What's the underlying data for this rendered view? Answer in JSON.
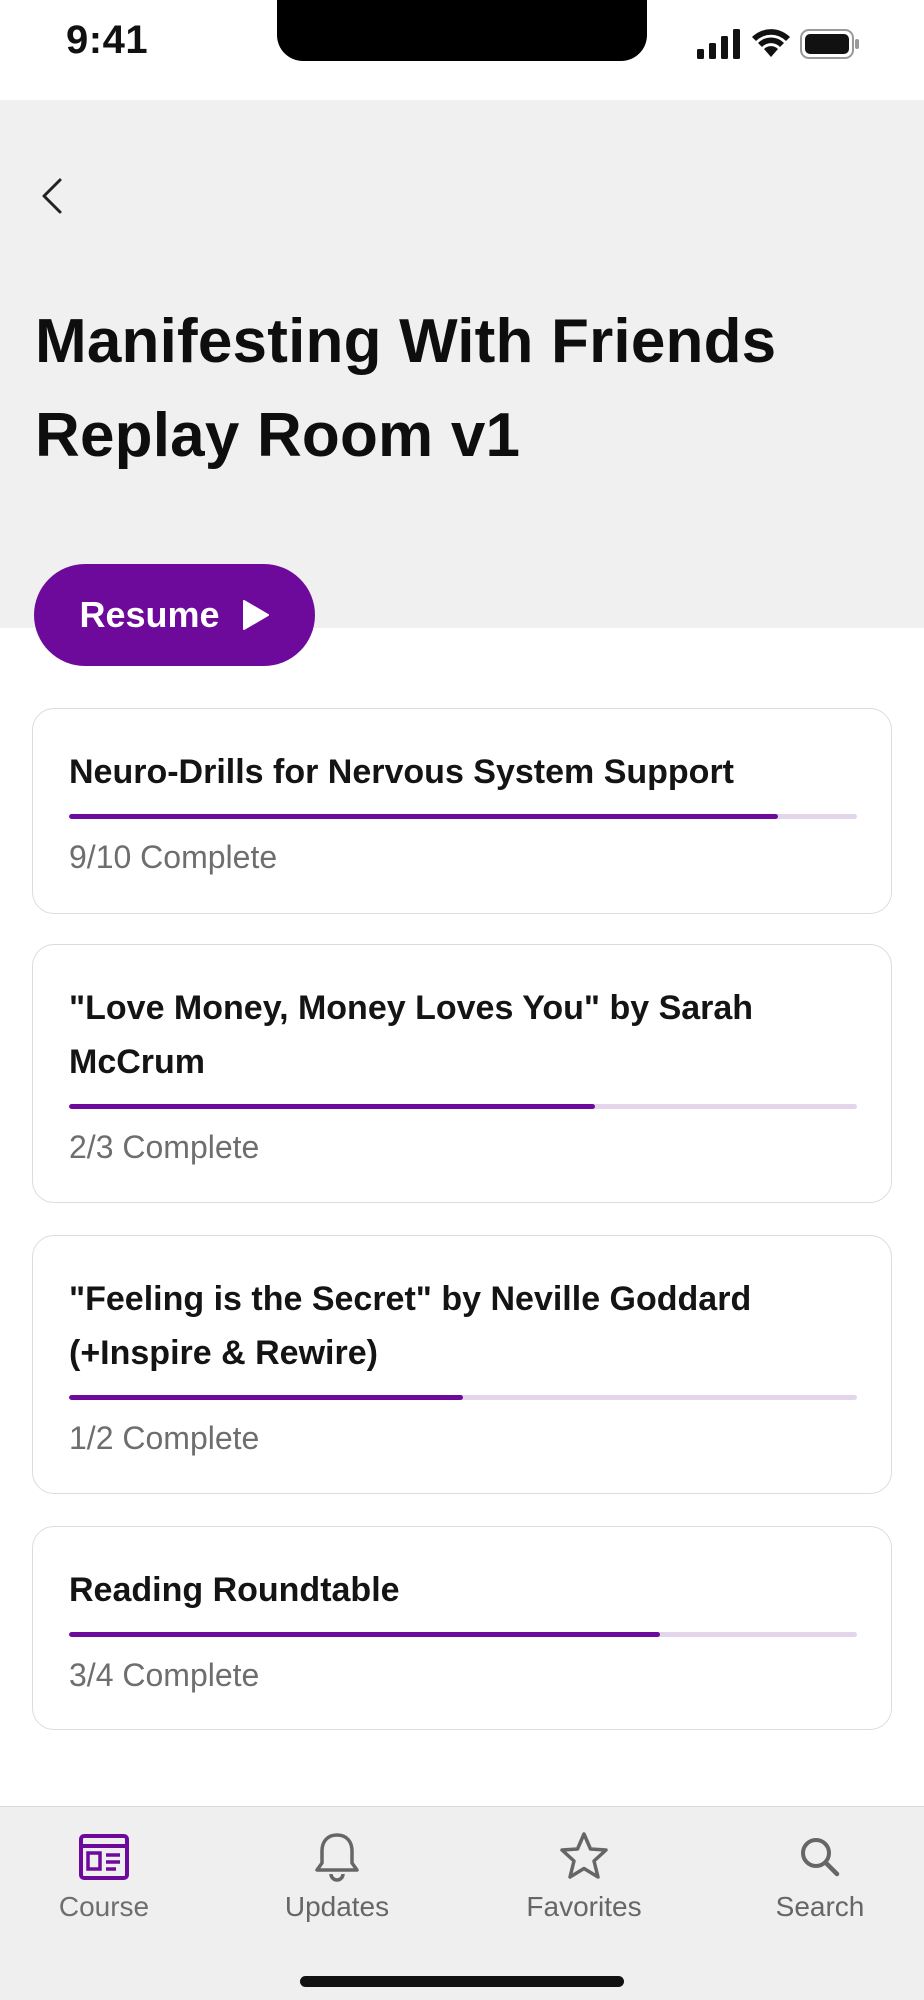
{
  "status_bar": {
    "time": "9:41"
  },
  "header": {
    "title_line1": "Manifesting With Friends",
    "title_line2": "Replay Room v1"
  },
  "resume_button": {
    "label": "Resume"
  },
  "courses": [
    {
      "title": "Neuro-Drills for Nervous System Support",
      "status": "9/10 Complete",
      "progress": 0.9
    },
    {
      "title": "\"Love Money, Money Loves You\" by Sarah McCrum",
      "status": "2/3 Complete",
      "progress": 0.667
    },
    {
      "title": "\"Feeling is the Secret\" by Neville Goddard (+Inspire & Rewire)",
      "status": "1/2 Complete",
      "progress": 0.5
    },
    {
      "title": "Reading Roundtable",
      "status": "3/4 Complete",
      "progress": 0.75
    }
  ],
  "nav": {
    "items": [
      {
        "label": "Course",
        "icon": "course-icon",
        "active": true
      },
      {
        "label": "Updates",
        "icon": "bell-icon",
        "active": false
      },
      {
        "label": "Favorites",
        "icon": "star-icon",
        "active": false
      },
      {
        "label": "Search",
        "icon": "search-icon",
        "active": false
      }
    ]
  },
  "colors": {
    "accent": "#6d0a9c",
    "header_bg": "#f0f0f0",
    "nav_bg": "#efefef"
  }
}
